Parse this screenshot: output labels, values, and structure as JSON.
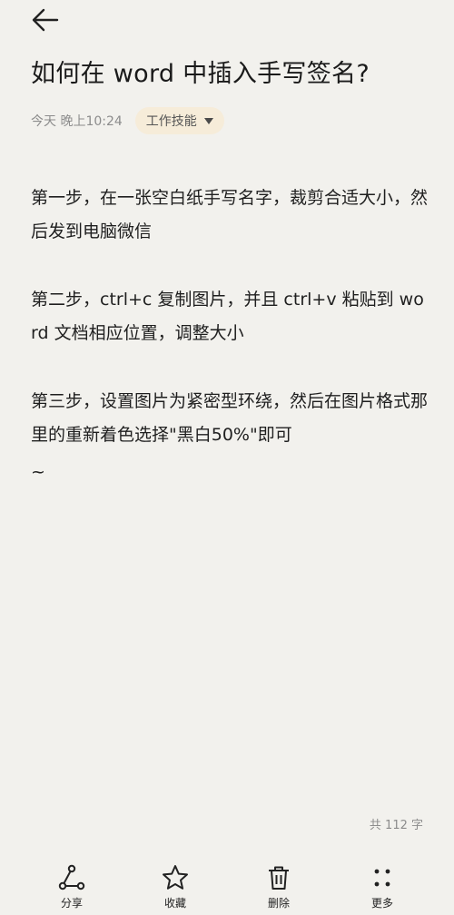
{
  "header": {
    "back_icon": "arrow-left-icon"
  },
  "note": {
    "title": "如何在 word 中插入手写签名?",
    "time": "今天 晚上10:24",
    "category": "工作技能",
    "paragraphs": [
      "第一步，在一张空白纸手写名字，裁剪合适大小，然后发到电脑微信",
      "第二步，ctrl+c 复制图片，并且 ctrl+v 粘贴到 word 文档相应位置，调整大小",
      "第三步，设置图片为紧密型环绕，然后在图片格式那里的重新着色选择\"黑白50%\"即可"
    ],
    "tail": "~",
    "word_count": "共 112 字"
  },
  "toolbar": {
    "share": "分享",
    "favorite": "收藏",
    "delete": "删除",
    "more": "更多"
  }
}
